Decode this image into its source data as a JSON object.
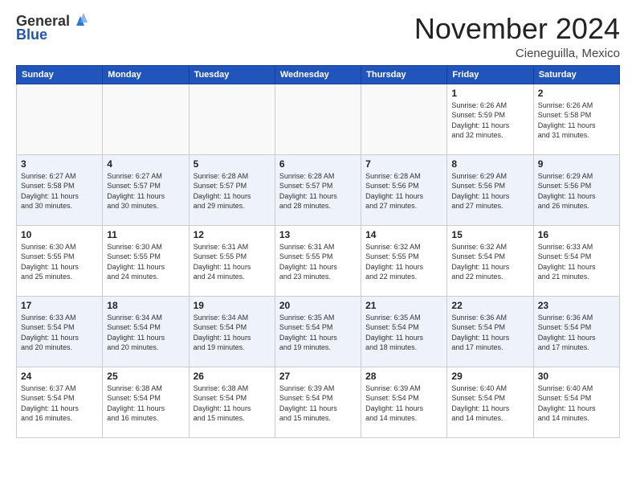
{
  "header": {
    "logo_line1": "General",
    "logo_line2": "Blue",
    "title": "November 2024",
    "location": "Cieneguilla, Mexico"
  },
  "calendar": {
    "weekdays": [
      "Sunday",
      "Monday",
      "Tuesday",
      "Wednesday",
      "Thursday",
      "Friday",
      "Saturday"
    ],
    "rows": [
      [
        {
          "day": "",
          "info": ""
        },
        {
          "day": "",
          "info": ""
        },
        {
          "day": "",
          "info": ""
        },
        {
          "day": "",
          "info": ""
        },
        {
          "day": "",
          "info": ""
        },
        {
          "day": "1",
          "info": "Sunrise: 6:26 AM\nSunset: 5:59 PM\nDaylight: 11 hours\nand 32 minutes."
        },
        {
          "day": "2",
          "info": "Sunrise: 6:26 AM\nSunset: 5:58 PM\nDaylight: 11 hours\nand 31 minutes."
        }
      ],
      [
        {
          "day": "3",
          "info": "Sunrise: 6:27 AM\nSunset: 5:58 PM\nDaylight: 11 hours\nand 30 minutes."
        },
        {
          "day": "4",
          "info": "Sunrise: 6:27 AM\nSunset: 5:57 PM\nDaylight: 11 hours\nand 30 minutes."
        },
        {
          "day": "5",
          "info": "Sunrise: 6:28 AM\nSunset: 5:57 PM\nDaylight: 11 hours\nand 29 minutes."
        },
        {
          "day": "6",
          "info": "Sunrise: 6:28 AM\nSunset: 5:57 PM\nDaylight: 11 hours\nand 28 minutes."
        },
        {
          "day": "7",
          "info": "Sunrise: 6:28 AM\nSunset: 5:56 PM\nDaylight: 11 hours\nand 27 minutes."
        },
        {
          "day": "8",
          "info": "Sunrise: 6:29 AM\nSunset: 5:56 PM\nDaylight: 11 hours\nand 27 minutes."
        },
        {
          "day": "9",
          "info": "Sunrise: 6:29 AM\nSunset: 5:56 PM\nDaylight: 11 hours\nand 26 minutes."
        }
      ],
      [
        {
          "day": "10",
          "info": "Sunrise: 6:30 AM\nSunset: 5:55 PM\nDaylight: 11 hours\nand 25 minutes."
        },
        {
          "day": "11",
          "info": "Sunrise: 6:30 AM\nSunset: 5:55 PM\nDaylight: 11 hours\nand 24 minutes."
        },
        {
          "day": "12",
          "info": "Sunrise: 6:31 AM\nSunset: 5:55 PM\nDaylight: 11 hours\nand 24 minutes."
        },
        {
          "day": "13",
          "info": "Sunrise: 6:31 AM\nSunset: 5:55 PM\nDaylight: 11 hours\nand 23 minutes."
        },
        {
          "day": "14",
          "info": "Sunrise: 6:32 AM\nSunset: 5:55 PM\nDaylight: 11 hours\nand 22 minutes."
        },
        {
          "day": "15",
          "info": "Sunrise: 6:32 AM\nSunset: 5:54 PM\nDaylight: 11 hours\nand 22 minutes."
        },
        {
          "day": "16",
          "info": "Sunrise: 6:33 AM\nSunset: 5:54 PM\nDaylight: 11 hours\nand 21 minutes."
        }
      ],
      [
        {
          "day": "17",
          "info": "Sunrise: 6:33 AM\nSunset: 5:54 PM\nDaylight: 11 hours\nand 20 minutes."
        },
        {
          "day": "18",
          "info": "Sunrise: 6:34 AM\nSunset: 5:54 PM\nDaylight: 11 hours\nand 20 minutes."
        },
        {
          "day": "19",
          "info": "Sunrise: 6:34 AM\nSunset: 5:54 PM\nDaylight: 11 hours\nand 19 minutes."
        },
        {
          "day": "20",
          "info": "Sunrise: 6:35 AM\nSunset: 5:54 PM\nDaylight: 11 hours\nand 19 minutes."
        },
        {
          "day": "21",
          "info": "Sunrise: 6:35 AM\nSunset: 5:54 PM\nDaylight: 11 hours\nand 18 minutes."
        },
        {
          "day": "22",
          "info": "Sunrise: 6:36 AM\nSunset: 5:54 PM\nDaylight: 11 hours\nand 17 minutes."
        },
        {
          "day": "23",
          "info": "Sunrise: 6:36 AM\nSunset: 5:54 PM\nDaylight: 11 hours\nand 17 minutes."
        }
      ],
      [
        {
          "day": "24",
          "info": "Sunrise: 6:37 AM\nSunset: 5:54 PM\nDaylight: 11 hours\nand 16 minutes."
        },
        {
          "day": "25",
          "info": "Sunrise: 6:38 AM\nSunset: 5:54 PM\nDaylight: 11 hours\nand 16 minutes."
        },
        {
          "day": "26",
          "info": "Sunrise: 6:38 AM\nSunset: 5:54 PM\nDaylight: 11 hours\nand 15 minutes."
        },
        {
          "day": "27",
          "info": "Sunrise: 6:39 AM\nSunset: 5:54 PM\nDaylight: 11 hours\nand 15 minutes."
        },
        {
          "day": "28",
          "info": "Sunrise: 6:39 AM\nSunset: 5:54 PM\nDaylight: 11 hours\nand 14 minutes."
        },
        {
          "day": "29",
          "info": "Sunrise: 6:40 AM\nSunset: 5:54 PM\nDaylight: 11 hours\nand 14 minutes."
        },
        {
          "day": "30",
          "info": "Sunrise: 6:40 AM\nSunset: 5:54 PM\nDaylight: 11 hours\nand 14 minutes."
        }
      ]
    ]
  }
}
